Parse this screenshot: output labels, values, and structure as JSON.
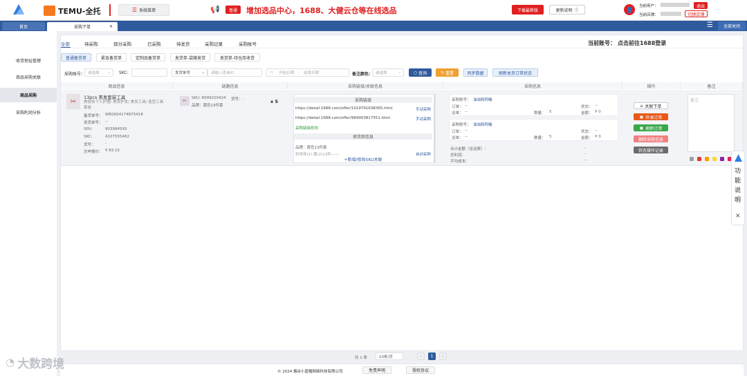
{
  "header": {
    "brand_name": "TEMU-全托",
    "system_menu": "系统菜单",
    "notice_badge": "普通",
    "notice_text": "增加选品中心，1688、大健云仓等在线选品",
    "download_btn": "下载最新版",
    "update_btn": "更新说明",
    "user_label": "当前用户：",
    "user_value": "········",
    "logout_btn": "退出",
    "shop_label": "当前店铺：",
    "shop_value": "········",
    "switch_shop_btn": "切换店铺"
  },
  "tabs": {
    "home": "首页",
    "active": "采购下单",
    "close_all": "全部关闭"
  },
  "sidebar": {
    "items": [
      "收货地址管理",
      "商品采购关联",
      "商品采购",
      "采购利润分析"
    ],
    "active_index": 2
  },
  "main": {
    "status_tabs": [
      "全部",
      "待采购",
      "部分采购",
      "已采购",
      "待发货",
      "采购记录",
      "采购账号"
    ],
    "account_label": "当前账号：",
    "account_value": "点击前往1688登录",
    "type_tabs": [
      "普通备货单",
      "紧急备货单",
      "定制品备货单",
      "发货单-袋箱发货",
      "发货单-待仓库收货"
    ],
    "filters": {
      "purchase_account_label": "采购账号：",
      "purchase_account_ph": "请选择",
      "skc_label": "SKC:",
      "ship_no_label": "发货单号",
      "ship_no_ph": "请输入查询ID",
      "start_date_ph": "开始日期",
      "date_sep": "-",
      "end_date_ph": "结束日期",
      "note_color_label": "备注颜色：",
      "note_color_ph": "请选择"
    },
    "buttons": {
      "query": "查询",
      "reset": "重置",
      "sync": "同步数据",
      "refresh_status": "刷新本页订单状态"
    },
    "columns": [
      "商品信息",
      "链路信息",
      "采购链接/关联信息",
      "采购信息",
      "操作",
      "备注"
    ]
  },
  "row": {
    "product_title": "13pcs 美发套装工具",
    "product_category": "美容和个人护理/ 美发护发/ 美发工具/ 造型工具套装",
    "fields": [
      {
        "k": "备货单号：",
        "v": "WB2604174875418"
      },
      {
        "k": "发货单号：",
        "v": "--"
      },
      {
        "k": "SPU:",
        "v": "903984593"
      },
      {
        "k": "SKC:",
        "v": "4107555462"
      },
      {
        "k": "货号：",
        "v": "-"
      },
      {
        "k": "总申报价：",
        "v": "¥ 83.15"
      }
    ],
    "link_sku": "SKU: 6099220424",
    "link_item_no": "货号：-",
    "link_spec": "品牌：黄色13件套",
    "link_qty": "x 5",
    "purchase_link_header": "采购链接",
    "purchase_links": [
      {
        "url": "https://detail.1688.com/offer/1019791638365.html",
        "action": "手动采购"
      },
      {
        "url": "https://detail.1688.com/offer/984003817551.html",
        "action": "手动采购"
      }
    ],
    "link_modify": "采购链接修改",
    "supplier_header": "供货商信息",
    "supplier_line1": "品牌：黄色13件套",
    "supplier_line2": "供货商(1):黄(2)13件——",
    "supplier_line2_action": "自动采购",
    "add_sku": "+新增/修改SKU关联",
    "purchase_blocks": [
      {
        "account_label": "采购账号：",
        "account": "油油和阿曦",
        "order_label": "订单：",
        "order": "--",
        "status_label": "状态：",
        "status": "--",
        "track_label": "运单：",
        "track": "--",
        "qty_label": "数量：",
        "qty": "5",
        "amount_label": "金额：",
        "amount": "¥ 0"
      },
      {
        "account_label": "采购账号：",
        "account": "油油和阿曦",
        "order_label": "订单：",
        "order": "--",
        "status_label": "状态：",
        "status": "--",
        "track_label": "运单：",
        "track": "--",
        "qty_label": "数量：",
        "qty": "5",
        "amount_label": "金额：",
        "amount": "¥ 0"
      }
    ],
    "totals": [
      {
        "k": "合计金额（含运费）:",
        "v": "-"
      },
      {
        "k": "总利润：",
        "v": "-"
      },
      {
        "k": "平均成本：",
        "v": "-"
      }
    ],
    "actions": [
      "关联下单",
      "补录订单",
      "刷新订单",
      "删除采购信息",
      "状态操作记录"
    ],
    "note_placeholder": "备注"
  },
  "note_colors": [
    "#9e9e9e",
    "#e53935",
    "#ff9800",
    "#fdd835",
    "#8e24aa",
    "#e91e63",
    "#43a047"
  ],
  "pagination": {
    "total": "共 1 条",
    "page_size": "10条/页",
    "current": "1"
  },
  "footer": {
    "copyright": "© 2024 烟台小蓝帽网络科技有限公司",
    "disclaimer_btn": "免责声明",
    "license_btn": "授权协议"
  },
  "help_widget": {
    "label": "功能说明"
  },
  "watermark": "大数跨境"
}
